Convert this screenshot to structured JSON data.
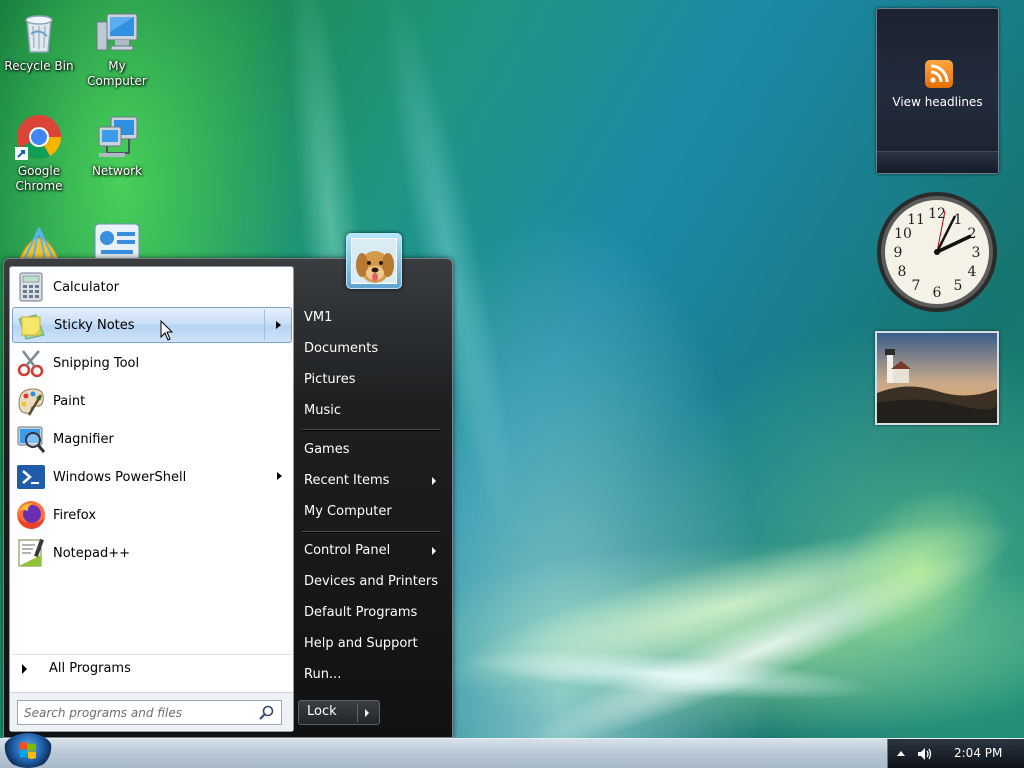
{
  "desktop": {
    "icons": [
      {
        "label": "Recycle Bin",
        "icon": "recycle-bin-icon"
      },
      {
        "label": "My Computer",
        "icon": "computer-icon"
      },
      {
        "label": "Google Chrome",
        "icon": "chrome-icon"
      },
      {
        "label": "Network",
        "icon": "network-icon"
      }
    ]
  },
  "gadgets": {
    "rss": {
      "label": "View headlines",
      "icon": "rss-icon"
    },
    "clock": {
      "time": "2:04"
    },
    "slideshow": {
      "icon": "photo-icon"
    }
  },
  "start_menu": {
    "pinned": [
      {
        "label": "Calculator",
        "icon": "calculator-icon",
        "submenu": false,
        "highlighted": false
      },
      {
        "label": "Sticky Notes",
        "icon": "sticky-notes-icon",
        "submenu": true,
        "highlighted": true
      },
      {
        "label": "Snipping Tool",
        "icon": "snipping-tool-icon",
        "submenu": false,
        "highlighted": false
      },
      {
        "label": "Paint",
        "icon": "paint-icon",
        "submenu": false,
        "highlighted": false
      },
      {
        "label": "Magnifier",
        "icon": "magnifier-icon",
        "submenu": false,
        "highlighted": false
      },
      {
        "label": "Windows PowerShell",
        "icon": "powershell-icon",
        "submenu": true,
        "highlighted": false
      },
      {
        "label": "Firefox",
        "icon": "firefox-icon",
        "submenu": false,
        "highlighted": false
      },
      {
        "label": "Notepad++",
        "icon": "notepad-plus-plus-icon",
        "submenu": false,
        "highlighted": false
      }
    ],
    "all_programs": "All Programs",
    "search_placeholder": "Search programs and files",
    "right": {
      "user_name": "VM1",
      "group1": [
        "Documents",
        "Pictures",
        "Music"
      ],
      "group2": [
        {
          "label": "Games",
          "submenu": false
        },
        {
          "label": "Recent Items",
          "submenu": true
        },
        {
          "label": "My Computer",
          "submenu": false
        }
      ],
      "group3": [
        {
          "label": "Control Panel",
          "submenu": true
        },
        {
          "label": "Devices and Printers",
          "submenu": false
        },
        {
          "label": "Default Programs",
          "submenu": false
        },
        {
          "label": "Help and Support",
          "submenu": false
        },
        {
          "label": "Run...",
          "submenu": false
        }
      ]
    },
    "lock_button": "Lock"
  },
  "taskbar": {
    "clock": "2:04 PM",
    "start_icon": "windows-logo-icon"
  },
  "colors": {
    "menu_highlight": "#c7def7",
    "menu_dark": "#1d1f21",
    "taskbar": "#b9c8d6"
  }
}
